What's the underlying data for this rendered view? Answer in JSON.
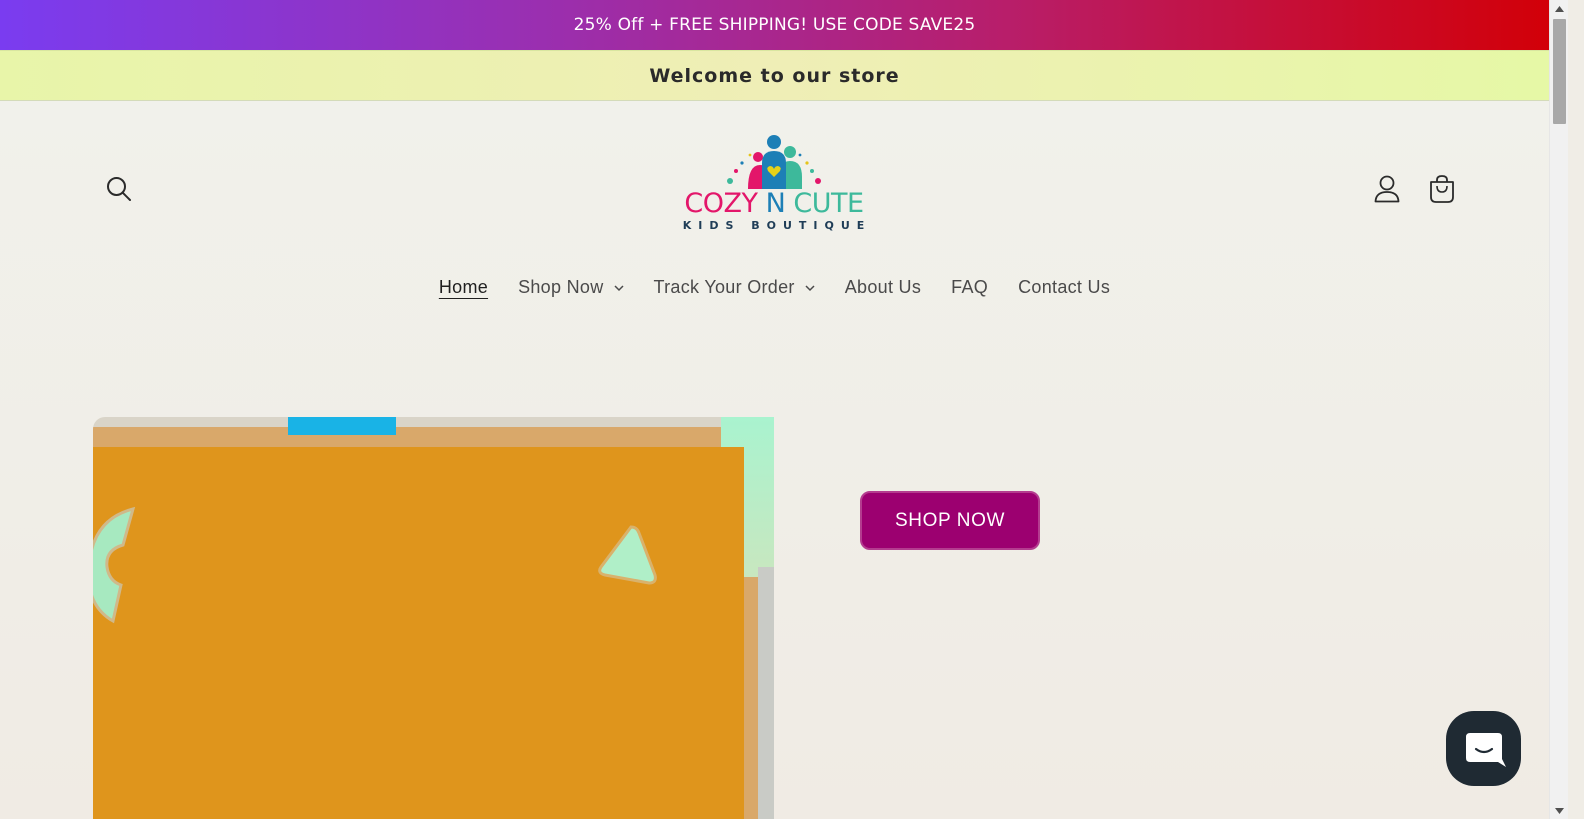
{
  "promo": {
    "text": "25% Off + FREE SHIPPING! USE CODE SAVE25"
  },
  "announcement": {
    "text": "Welcome to our store"
  },
  "logo": {
    "title_part1": "COZY",
    "title_part2": "N",
    "title_part3": "CUTE",
    "subtitle": "KIDS BOUTIQUE"
  },
  "header_icons": {
    "search": "search-icon",
    "account": "user-icon",
    "cart": "shopping-bag-icon"
  },
  "nav": {
    "items": [
      {
        "label": "Home",
        "active": true,
        "dropdown": false
      },
      {
        "label": "Shop Now",
        "active": false,
        "dropdown": true
      },
      {
        "label": "Track Your Order",
        "active": false,
        "dropdown": true
      },
      {
        "label": "About Us",
        "active": false,
        "dropdown": false
      },
      {
        "label": "FAQ",
        "active": false,
        "dropdown": false
      },
      {
        "label": "Contact Us",
        "active": false,
        "dropdown": false
      }
    ]
  },
  "hero": {
    "cta_label": "SHOP NOW"
  },
  "chat": {
    "icon": "chat-bubble-icon"
  },
  "colors": {
    "promo_start": "#7a3cf0",
    "promo_end": "#d20008",
    "announcement_bg": "#eef2b4",
    "cta_bg": "#9c0070",
    "chat_bg": "#1f2a33",
    "hero_orange": "#df951c"
  }
}
